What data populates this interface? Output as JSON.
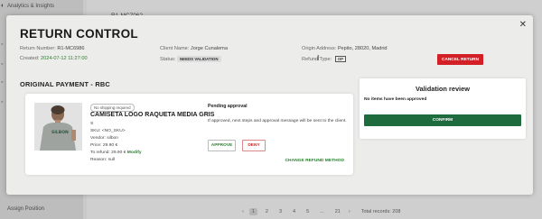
{
  "background": {
    "sidebar": {
      "top_item": "Analytics & Insights",
      "bottom_item": "Assign Position"
    },
    "row_code": "R1-MC7062",
    "pagination": {
      "pages": [
        "1",
        "2",
        "3",
        "4",
        "5",
        "...",
        "21"
      ],
      "active_page": "1",
      "total": "Total records: 208"
    }
  },
  "modal": {
    "title": "RETURN CONTROL",
    "close_glyph": "✕",
    "return_number_label": "Return Number:",
    "return_number": "R1-MC6986",
    "created_label": "Created:",
    "created": "2024-07-12 11:27:00",
    "client_name_label": "Client Name:",
    "client_name": "Jorge Cunalema",
    "status_label": "Status:",
    "status": "NEEDS VALIDATION",
    "origin_label": "Origin Address:",
    "origin": "Pepito, 28020, Madrid",
    "refund_type_label": "Refund Type:",
    "refund_type": "OP",
    "cancel_button": "CANCEL RETURN",
    "section_title": "ORIGINAL PAYMENT - RBC",
    "product": {
      "shipping_tag": "No shipping required",
      "name": "CAMISETA LOGO RAQUETA MEDIA GRIS",
      "size": "S",
      "sku": "SKU: <NO_SKU>",
      "vendor": "Vendor: silbon",
      "price": "Price: 29.90 €",
      "to_refund_label": "To refund:",
      "to_refund": "29.90 €",
      "modify": "Modify",
      "reason": "Reason: null"
    },
    "pending": {
      "title": "Pending approval",
      "message": "If approved, next steps and approval message will be sent to the client.",
      "approve": "APPROVE",
      "deny": "DENY",
      "change_method": "CHANGE REFUND METHOD"
    },
    "validation": {
      "title": "Validation review",
      "message": "No items have been approved",
      "confirm": "CONFIRM"
    }
  },
  "colors": {
    "accent_green": "#1e6b3e",
    "danger_red": "#d32027"
  }
}
